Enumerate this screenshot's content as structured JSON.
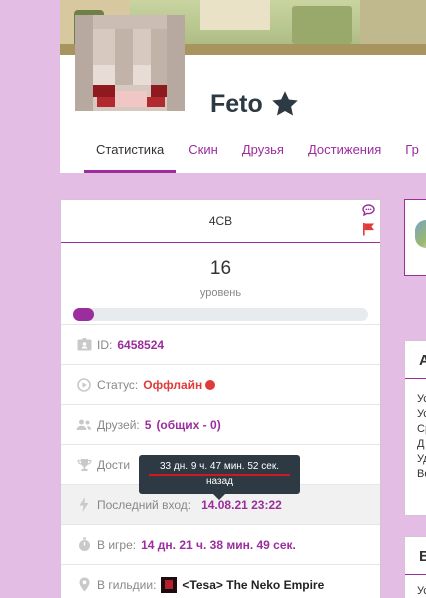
{
  "profile": {
    "username": "Feto",
    "banner_colors": {
      "sky": "#c9d4a0",
      "ground": "#a7945f"
    }
  },
  "tabs": [
    {
      "label": "Статистика",
      "active": true
    },
    {
      "label": "Скин",
      "active": false
    },
    {
      "label": "Друзья",
      "active": false
    },
    {
      "label": "Достижения",
      "active": false
    },
    {
      "label": "Гр",
      "active": false
    }
  ],
  "stats": {
    "code": "4CB",
    "level": "16",
    "level_label": "уровень",
    "level_progress_fraction": 0.07,
    "id_label": "ID:",
    "id_value": "6458524",
    "status_label": "Статус:",
    "status_value": "Оффлайн",
    "friends_label": "Друзей:",
    "friends_count": "5",
    "friends_common": "(общих - 0)",
    "achievements_label": "Дости",
    "last_login_label": "Последний вход:",
    "last_login_value": "14.08.21 23:22",
    "ingame_label": "В игре:",
    "ingame_value": "14 дн. 21 ч. 38 мин. 49 сек.",
    "guild_label": "В гильдии:",
    "guild_name": "<Tesa> The Neko Empire"
  },
  "tooltip": {
    "line1": "33 дн. 9 ч. 47 мин. 52 сек.",
    "line2": "назад"
  },
  "side": {
    "card2_head": "А",
    "card2_lines": [
      "Ус",
      "Ус",
      "Ср",
      "Д",
      "Уд",
      "Во"
    ],
    "card3_head": "В",
    "card3_line": "Ус"
  },
  "colors": {
    "page_bg": "#e3bde3",
    "accent": "#9b2d9d",
    "offline": "#e03a3a",
    "tooltip_bg": "#2d3a43"
  },
  "icons": [
    "star-icon",
    "chat-icon",
    "flag-icon",
    "id-card-icon",
    "play-icon",
    "users-icon",
    "trophy-icon",
    "bolt-icon",
    "stopwatch-icon",
    "map-pin-icon"
  ]
}
